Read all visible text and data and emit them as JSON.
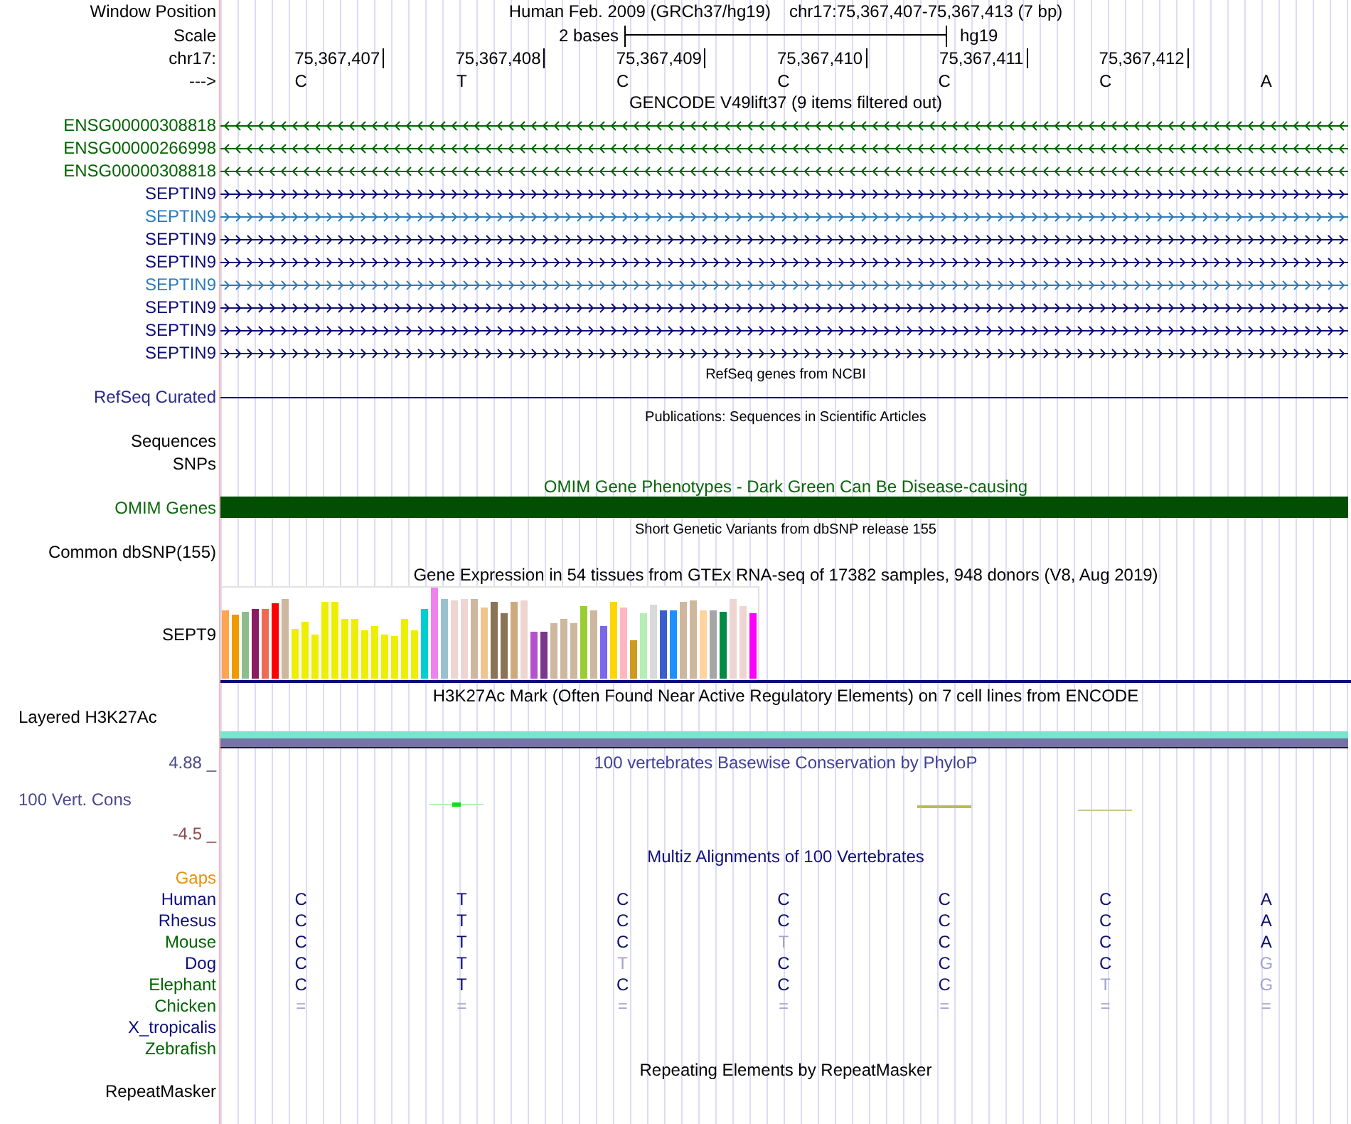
{
  "header": {
    "label": "Window Position",
    "assembly": "Human Feb. 2009 (GRCh37/hg19)",
    "position": "chr17:75,367,407-75,367,413 (7 bp)"
  },
  "scale": {
    "label": "Scale",
    "span": "2 bases",
    "assembly": "hg19"
  },
  "ruler": {
    "label": "chr17:",
    "positions": [
      "75,367,407",
      "75,367,408",
      "75,367,409",
      "75,367,410",
      "75,367,411",
      "75,367,412"
    ]
  },
  "sequence": {
    "label": "--->",
    "bases": [
      "C",
      "T",
      "C",
      "C",
      "C",
      "C",
      "A"
    ]
  },
  "gencode": {
    "title": "GENCODE V49lift37 (9 items filtered out)",
    "items": [
      {
        "name": "ENSG00000308818",
        "color": "#006400",
        "reverse": true
      },
      {
        "name": "ENSG00000266998",
        "color": "#006400",
        "reverse": true
      },
      {
        "name": "ENSG00000308818",
        "color": "#006400",
        "reverse": true
      },
      {
        "name": "SEPTIN9",
        "color": "#0c0c78",
        "reverse": false
      },
      {
        "name": "SEPTIN9",
        "color": "#2b7bbd",
        "reverse": false
      },
      {
        "name": "SEPTIN9",
        "color": "#0c0c78",
        "reverse": false
      },
      {
        "name": "SEPTIN9",
        "color": "#0c0c78",
        "reverse": false
      },
      {
        "name": "SEPTIN9",
        "color": "#2b7bbd",
        "reverse": false
      },
      {
        "name": "SEPTIN9",
        "color": "#0c0c78",
        "reverse": false
      },
      {
        "name": "SEPTIN9",
        "color": "#0c0c78",
        "reverse": false
      },
      {
        "name": "SEPTIN9",
        "color": "#0c0c78",
        "reverse": false
      }
    ]
  },
  "refseq": {
    "title": "RefSeq genes from NCBI",
    "label": "RefSeq Curated"
  },
  "publications": {
    "title": "Publications: Sequences in Scientific Articles",
    "labels": [
      "Sequences",
      "SNPs"
    ]
  },
  "omim": {
    "title": "OMIM Gene Phenotypes - Dark Green Can Be Disease-causing",
    "label": "OMIM Genes"
  },
  "dbsnp": {
    "title": "Short Genetic Variants from dbSNP release 155",
    "label": "Common dbSNP(155)"
  },
  "gtex": {
    "title": "Gene Expression in 54 tissues from GTEx RNA-seq of 17382 samples, 948 donors (V8, Aug 2019)",
    "label": "SEPT9"
  },
  "h3k27ac": {
    "title": "H3K27Ac Mark (Often Found Near Active Regulatory Elements) on 7 cell lines from ENCODE",
    "label": "Layered H3K27Ac"
  },
  "conservation": {
    "title": "100 vertebrates Basewise Conservation by PhyloP",
    "label": "100 Vert. Cons",
    "max": "4.88 _",
    "min": "-4.5 _"
  },
  "multiz": {
    "title": "Multiz Alignments of 100 Vertebrates",
    "rows": [
      {
        "label": "Gaps",
        "color": "#e8900c"
      },
      {
        "label": "Human",
        "color": "#0c0c78",
        "bases": [
          {
            "base": "C",
            "conserved": true
          },
          {
            "base": "T",
            "conserved": true
          },
          {
            "base": "C",
            "conserved": true
          },
          {
            "base": "C",
            "conserved": true
          },
          {
            "base": "C",
            "conserved": true
          },
          {
            "base": "C",
            "conserved": true
          },
          {
            "base": "A",
            "conserved": true
          }
        ]
      },
      {
        "label": "Rhesus",
        "color": "#0c0c78",
        "bases": [
          {
            "base": "C",
            "conserved": true
          },
          {
            "base": "T",
            "conserved": true
          },
          {
            "base": "C",
            "conserved": true
          },
          {
            "base": "C",
            "conserved": true
          },
          {
            "base": "C",
            "conserved": true
          },
          {
            "base": "C",
            "conserved": true
          },
          {
            "base": "A",
            "conserved": true
          }
        ]
      },
      {
        "label": "Mouse",
        "color": "#006400",
        "bases": [
          {
            "base": "C",
            "conserved": true
          },
          {
            "base": "T",
            "conserved": true
          },
          {
            "base": "C",
            "conserved": true
          },
          {
            "base": "T",
            "conserved": false
          },
          {
            "base": "C",
            "conserved": true
          },
          {
            "base": "C",
            "conserved": true
          },
          {
            "base": "A",
            "conserved": true
          }
        ]
      },
      {
        "label": "Dog",
        "color": "#0c0c78",
        "bases": [
          {
            "base": "C",
            "conserved": true
          },
          {
            "base": "T",
            "conserved": true
          },
          {
            "base": "T",
            "conserved": false
          },
          {
            "base": "C",
            "conserved": true
          },
          {
            "base": "C",
            "conserved": true
          },
          {
            "base": "C",
            "conserved": true
          },
          {
            "base": "G",
            "conserved": false
          }
        ]
      },
      {
        "label": "Elephant",
        "color": "#006400",
        "bases": [
          {
            "base": "C",
            "conserved": true
          },
          {
            "base": "T",
            "conserved": true
          },
          {
            "base": "C",
            "conserved": true
          },
          {
            "base": "C",
            "conserved": true
          },
          {
            "base": "C",
            "conserved": true
          },
          {
            "base": "T",
            "conserved": false
          },
          {
            "base": "G",
            "conserved": false
          }
        ]
      },
      {
        "label": "Chicken",
        "color": "#006400",
        "bases": [
          {
            "base": "=",
            "conserved": false
          },
          {
            "base": "=",
            "conserved": false
          },
          {
            "base": "=",
            "conserved": false
          },
          {
            "base": "=",
            "conserved": false
          },
          {
            "base": "=",
            "conserved": false
          },
          {
            "base": "=",
            "conserved": false
          },
          {
            "base": "=",
            "conserved": false
          }
        ]
      },
      {
        "label": "X_tropicalis",
        "color": "#0c0c78"
      },
      {
        "label": "Zebrafish",
        "color": "#006400"
      }
    ]
  },
  "repeatmasker": {
    "title": "Repeating Elements by RepeatMasker",
    "label": "RepeatMasker"
  }
}
